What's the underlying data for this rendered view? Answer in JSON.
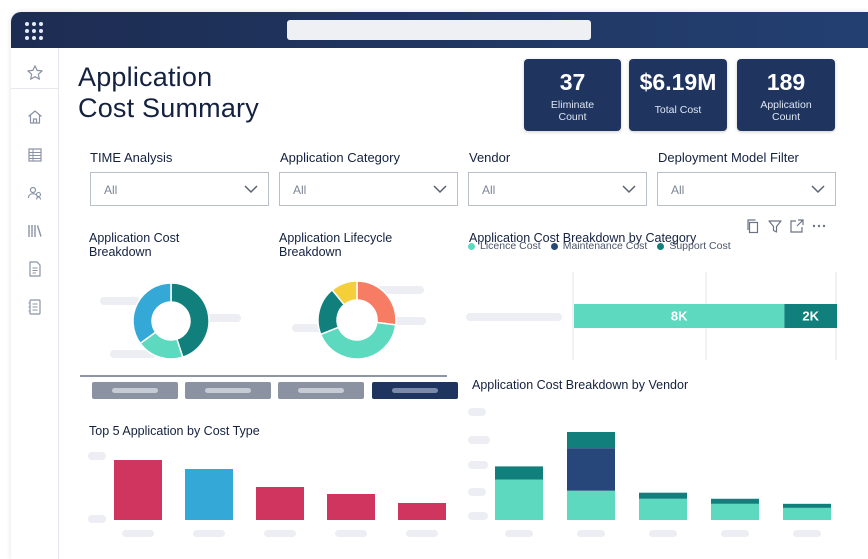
{
  "page": {
    "title_line1": "Application",
    "title_line2": "Cost Summary"
  },
  "kpis": [
    {
      "value": "37",
      "label_line1": "Eliminate",
      "label_line2": "Count"
    },
    {
      "value": "$6.19M",
      "label_line1": "Total Cost",
      "label_line2": ""
    },
    {
      "value": "189",
      "label_line1": "Application",
      "label_line2": "Count"
    }
  ],
  "filters": [
    {
      "label": "TIME Analysis",
      "value": "All"
    },
    {
      "label": "Application Category",
      "value": "All"
    },
    {
      "label": "Vendor",
      "value": "All"
    },
    {
      "label": "Deployment Model Filter",
      "value": "All"
    }
  ],
  "sidebar_icons": [
    "star-icon",
    "home-icon",
    "table-icon",
    "users-icon",
    "library-icon",
    "document-icon",
    "report-icon"
  ],
  "colors": {
    "navy": "#1f3560",
    "teal_light": "#5dd9bf",
    "teal_dark": "#11807d",
    "blue_dark": "#27467a",
    "crimson": "#d03560",
    "sky": "#34a8d6",
    "yellow": "#f5cf3a",
    "salmon": "#f77c64"
  },
  "chart_data": [
    {
      "type": "pie",
      "title": "Application Cost Breakdown",
      "slices": [
        {
          "color": "#11807d",
          "value": 45
        },
        {
          "color": "#5dd9bf",
          "value": 20
        },
        {
          "color": "#34a8d6",
          "value": 35
        }
      ]
    },
    {
      "type": "pie",
      "title": "Application Lifecycle Breakdown",
      "slices": [
        {
          "color": "#f77c64",
          "value": 27
        },
        {
          "color": "#5dd9bf",
          "value": 42
        },
        {
          "color": "#11807d",
          "value": 20
        },
        {
          "color": "#f5cf3a",
          "value": 11
        }
      ]
    },
    {
      "type": "bar",
      "orientation": "horizontal",
      "stacked": true,
      "title": "Application Cost Breakdown by Category",
      "legend": [
        "Licence Cost",
        "Maintenance Cost",
        "Support Cost"
      ],
      "segments": [
        {
          "series": "Licence Cost",
          "value": 8,
          "label": "8K",
          "color": "#5dd9bf"
        },
        {
          "series": "Support Cost",
          "value": 2,
          "label": "2K",
          "color": "#11807d"
        }
      ]
    },
    {
      "type": "bar",
      "stacked": true,
      "title": "Application Cost Breakdown by Vendor",
      "bars": [
        {
          "segments": [
            {
              "value": 40,
              "color": "#5dd9bf"
            },
            {
              "value": 13,
              "color": "#11807d"
            }
          ]
        },
        {
          "segments": [
            {
              "value": 29,
              "color": "#5dd9bf"
            },
            {
              "value": 42,
              "color": "#27467a"
            },
            {
              "value": 16,
              "color": "#11807d"
            }
          ]
        },
        {
          "segments": [
            {
              "value": 21,
              "color": "#5dd9bf"
            },
            {
              "value": 6,
              "color": "#11807d"
            }
          ]
        },
        {
          "segments": [
            {
              "value": 16,
              "color": "#5dd9bf"
            },
            {
              "value": 5,
              "color": "#11807d"
            }
          ]
        },
        {
          "segments": [
            {
              "value": 12,
              "color": "#5dd9bf"
            },
            {
              "value": 4,
              "color": "#11807d"
            }
          ]
        }
      ]
    },
    {
      "type": "bar",
      "title": "Top 5 Application by Cost Type",
      "bars": [
        {
          "value": 60,
          "color": "#d03560"
        },
        {
          "value": 51,
          "color": "#34a8d6"
        },
        {
          "value": 33,
          "color": "#d03560"
        },
        {
          "value": 26,
          "color": "#d03560"
        },
        {
          "value": 17,
          "color": "#d03560"
        }
      ]
    }
  ]
}
